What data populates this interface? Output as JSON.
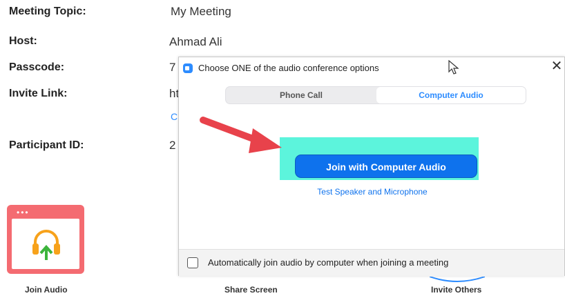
{
  "meeting_info": {
    "topic_label": "Meeting Topic:",
    "topic_value": "My Meeting",
    "host_label": "Host:",
    "host_value": "Ahmad Ali",
    "passcode_label": "Passcode:",
    "passcode_value_partial": "7",
    "invite_label": "Invite Link:",
    "invite_value_partial": "ht",
    "copy_link_partial": "C",
    "participant_label": "Participant ID:",
    "participant_value_partial": "2"
  },
  "toolbar": {
    "join_audio": "Join Audio",
    "share_screen": "Share Screen",
    "invite_others": "Invite Others"
  },
  "dialog": {
    "title": "Choose ONE of the audio conference options",
    "tabs": [
      {
        "label": "Phone Call",
        "selected": false
      },
      {
        "label": "Computer Audio",
        "selected": true
      }
    ],
    "join_button": "Join with Computer Audio",
    "test_link": "Test Speaker and Microphone",
    "auto_join_label": "Automatically join audio by computer when joining a meeting",
    "auto_join_checked": false
  },
  "colors": {
    "accent": "#0e72ed",
    "highlight": "#5cf4dc",
    "arrow": "#e8424b",
    "tile": "#f46b71",
    "headphones": "#f7a21b",
    "upload_arrow": "#3cb43c"
  },
  "icons": [
    "zoom-logo-icon",
    "close-icon",
    "mouse-cursor-icon",
    "headphones-icon",
    "upload-arrow-icon",
    "red-arrow-icon",
    "window-dots-icon"
  ]
}
